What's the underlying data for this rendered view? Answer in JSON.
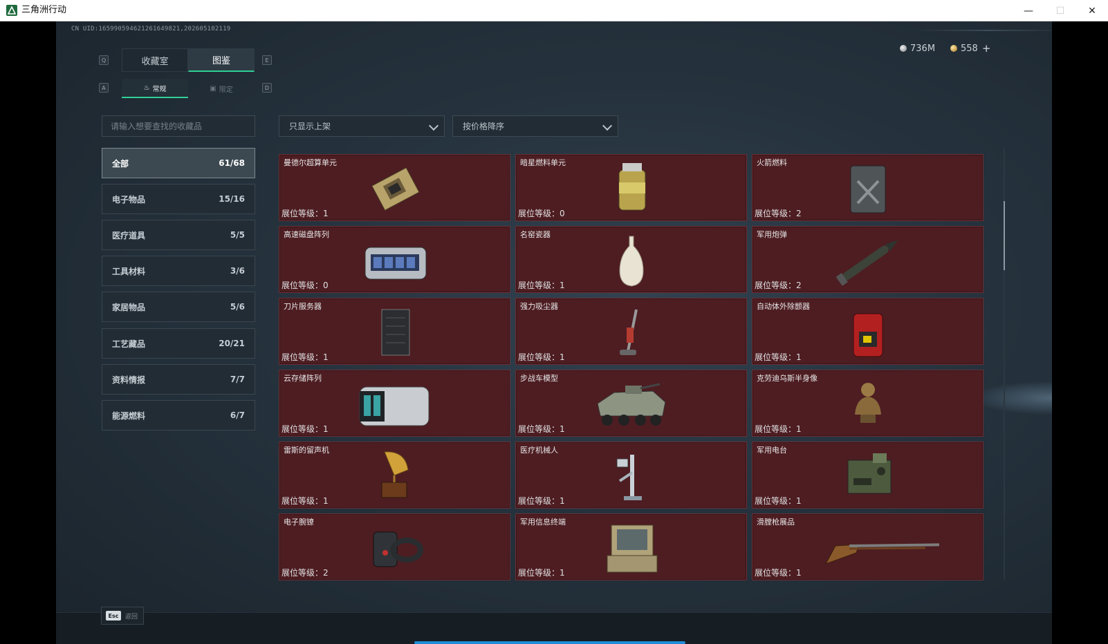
{
  "window": {
    "title": "三角洲行动",
    "minimize": "—",
    "maximize": "☐",
    "close": "✕"
  },
  "uid": "CN UID:1659905946212616498​21,202605102119",
  "currency": {
    "silver": "736M",
    "gold": "558",
    "plus": "+"
  },
  "hotkeys": {
    "prev_main": "Q",
    "next_main": "E",
    "prev_sub": "A",
    "next_sub": "D"
  },
  "tabs": {
    "main": [
      "收藏室",
      "图鉴"
    ],
    "sub": [
      "常规",
      "限定"
    ]
  },
  "search": {
    "placeholder": "请输入想要查找的收藏品"
  },
  "filters": {
    "listing": "只显示上架",
    "sort": "按价格降序"
  },
  "categories": [
    {
      "name": "全部",
      "count": "61/68"
    },
    {
      "name": "电子物品",
      "count": "15/16"
    },
    {
      "name": "医疗道具",
      "count": "5/5"
    },
    {
      "name": "工具材料",
      "count": "3/6"
    },
    {
      "name": "家居物品",
      "count": "5/6"
    },
    {
      "name": "工艺藏品",
      "count": "20/21"
    },
    {
      "name": "资料情报",
      "count": "7/7"
    },
    {
      "name": "能源燃料",
      "count": "6/7"
    }
  ],
  "items": [
    {
      "name": "曼德尔超算单元",
      "level": "展位等级：1",
      "icon": "supercomputer-chip-icon"
    },
    {
      "name": "暗星燃料单元",
      "level": "展位等级：0",
      "icon": "fuel-canister-icon"
    },
    {
      "name": "火箭燃料",
      "level": "展位等级：2",
      "icon": "jerry-can-icon"
    },
    {
      "name": "高速磁盘阵列",
      "level": "展位等级：0",
      "icon": "disk-array-icon"
    },
    {
      "name": "名窑瓷器",
      "level": "展位等级：1",
      "icon": "porcelain-vase-icon"
    },
    {
      "name": "军用炮弹",
      "level": "展位等级：2",
      "icon": "artillery-shell-icon"
    },
    {
      "name": "刀片服务器",
      "level": "展位等级：1",
      "icon": "blade-server-icon"
    },
    {
      "name": "强力吸尘器",
      "level": "展位等级：1",
      "icon": "vacuum-cleaner-icon"
    },
    {
      "name": "自动体外除颤器",
      "level": "展位等级：1",
      "icon": "defibrillator-icon"
    },
    {
      "name": "云存储阵列",
      "level": "展位等级：1",
      "icon": "cloud-storage-icon"
    },
    {
      "name": "步战车模型",
      "level": "展位等级：1",
      "icon": "ifv-model-icon"
    },
    {
      "name": "克劳迪乌斯半身像",
      "level": "展位等级：1",
      "icon": "bust-statue-icon"
    },
    {
      "name": "雷斯的留声机",
      "level": "展位等级：1",
      "icon": "gramophone-icon"
    },
    {
      "name": "医疗机械人",
      "level": "展位等级：1",
      "icon": "medical-robot-icon"
    },
    {
      "name": "军用电台",
      "level": "展位等级：1",
      "icon": "military-radio-icon"
    },
    {
      "name": "电子腕镣",
      "level": "展位等级：2",
      "icon": "electronic-shackle-icon"
    },
    {
      "name": "军用信息终端",
      "level": "展位等级：1",
      "icon": "military-terminal-icon"
    },
    {
      "name": "滑膛枪展品",
      "level": "展位等级：1",
      "icon": "musket-icon"
    }
  ],
  "footer": {
    "esc_key": "Esc",
    "esc_label": "返回"
  },
  "colors": {
    "accent": "#2fd196",
    "card_bg": "#4d1d22",
    "progress": "#1f8cd8"
  }
}
